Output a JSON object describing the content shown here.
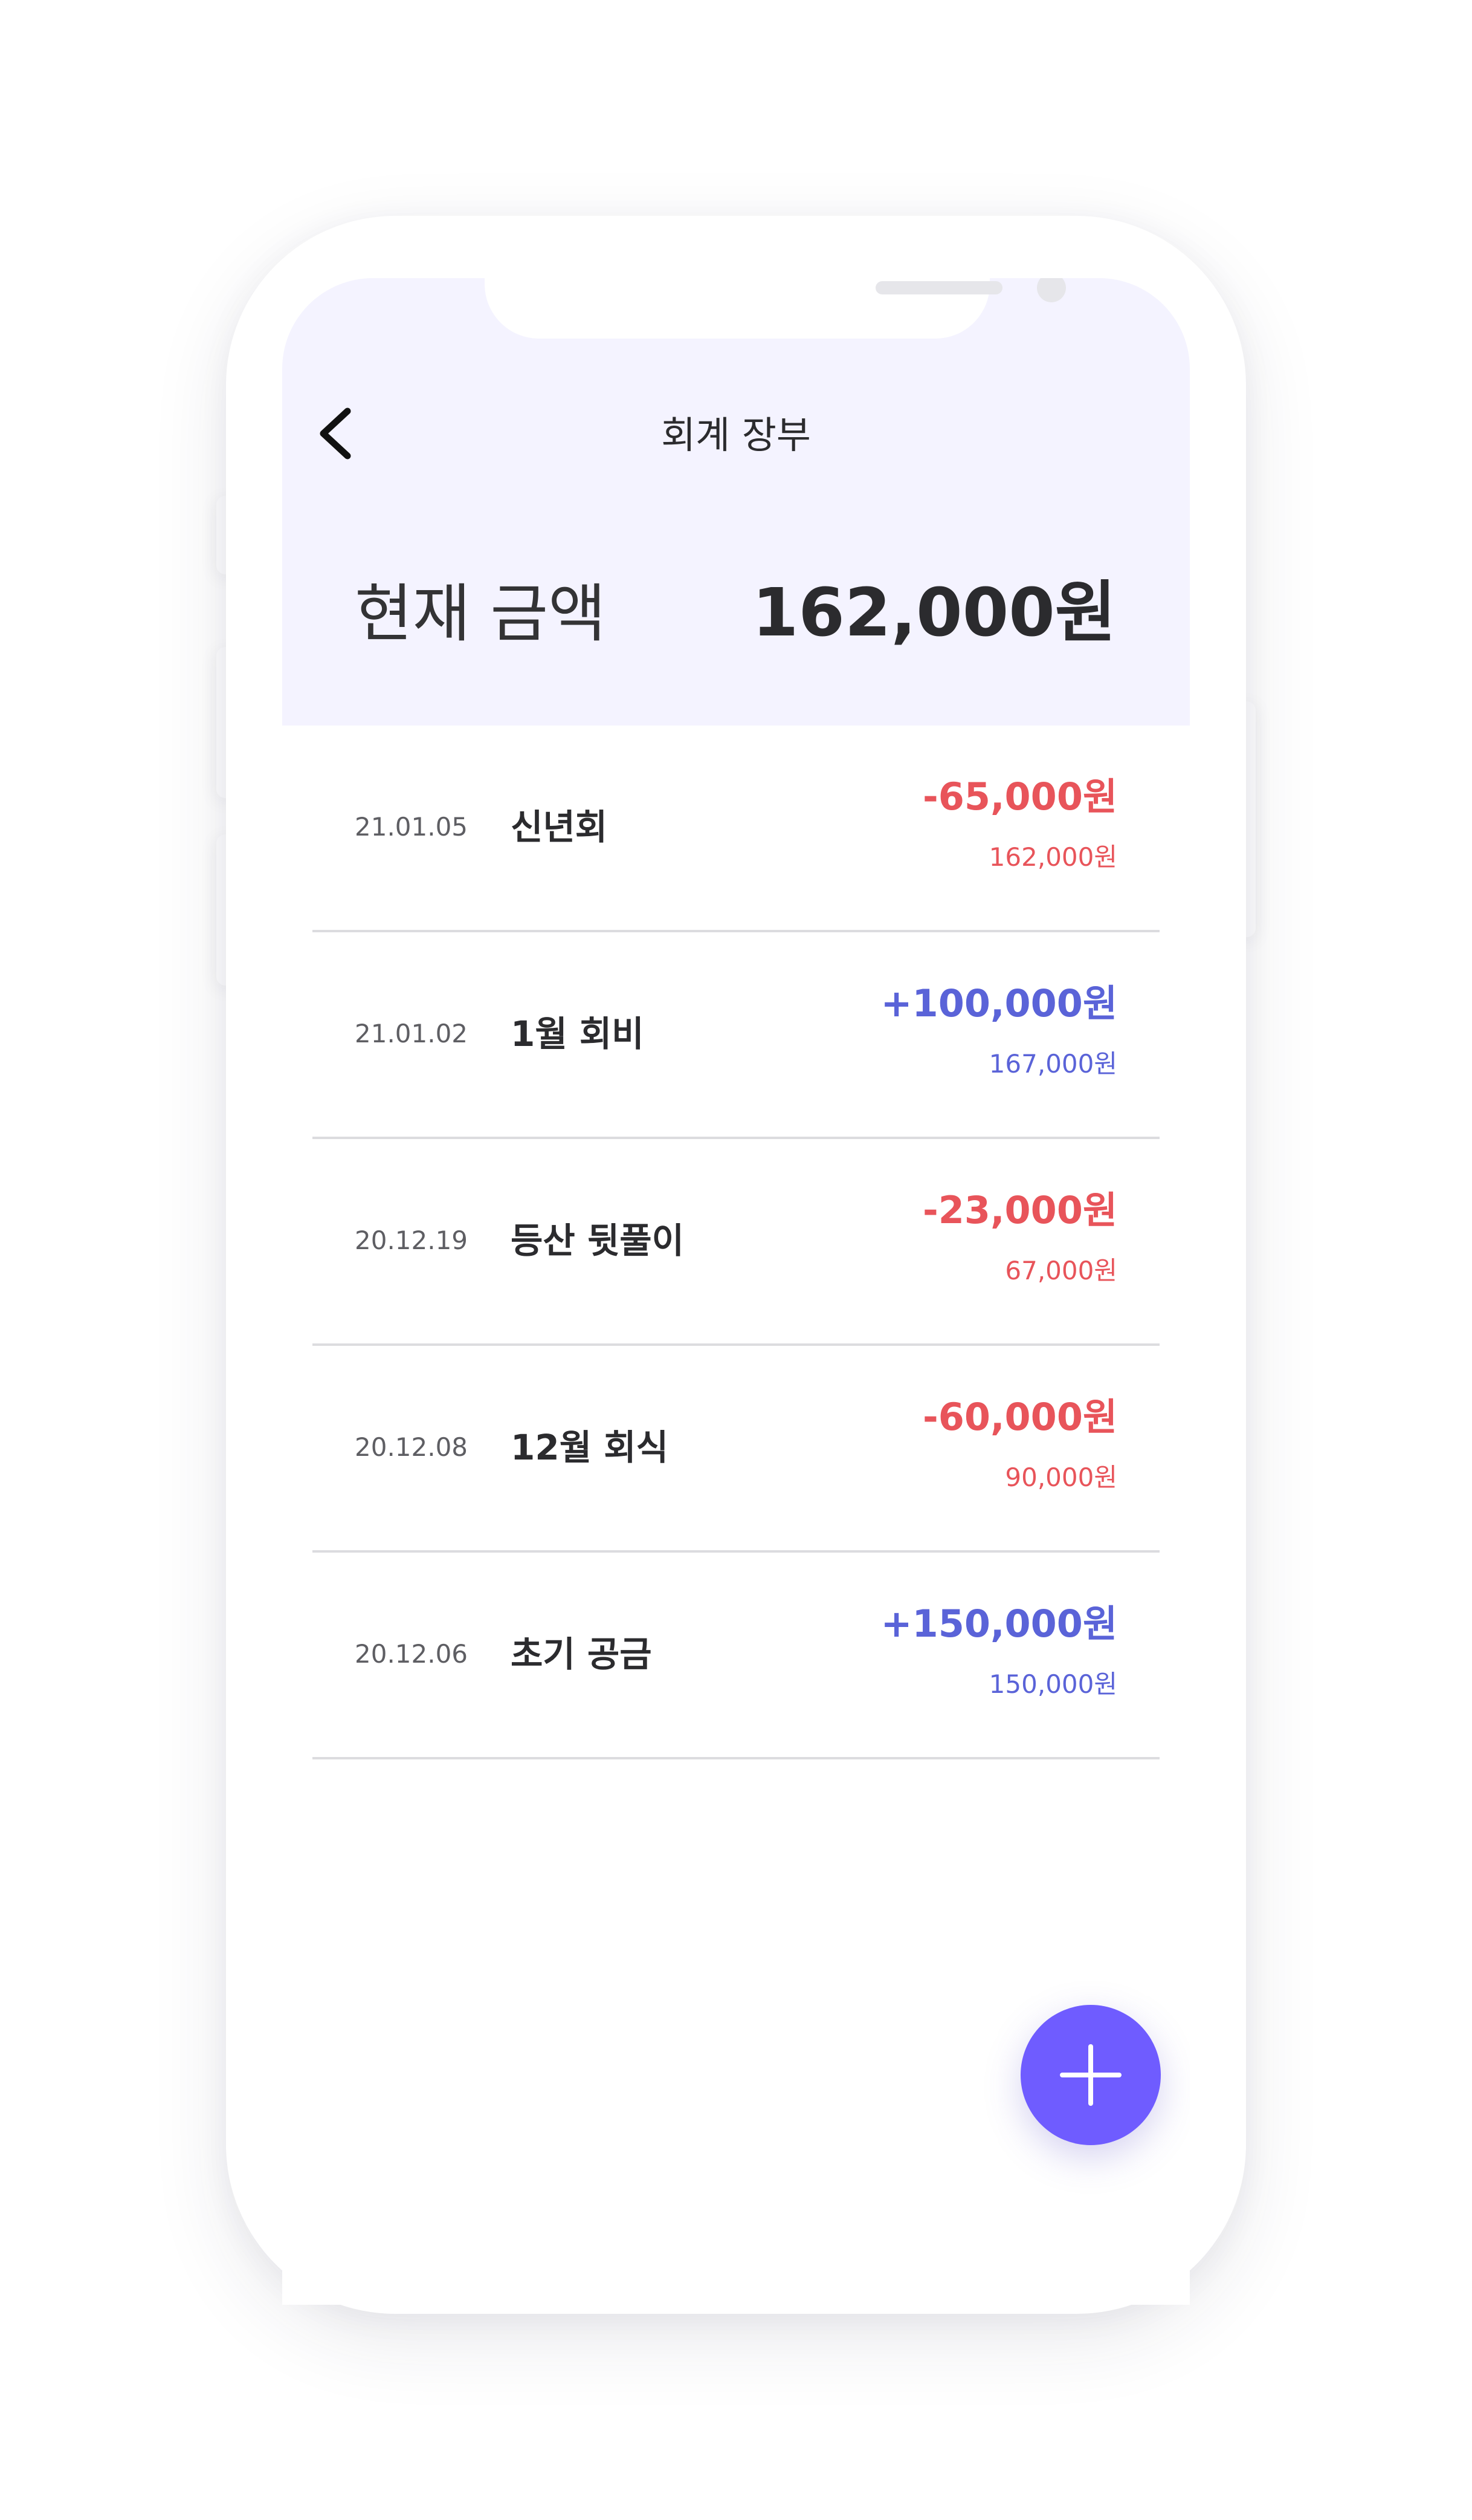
{
  "app": {
    "title": "회계 장부"
  },
  "summary": {
    "label": "현재 금액",
    "amount": "162,000원"
  },
  "transactions": [
    {
      "date": "21.01.05",
      "name": "신년회",
      "amount": "-65,000원",
      "balance": "162,000원",
      "type": "expense"
    },
    {
      "date": "21.01.02",
      "name": "1월 회비",
      "amount": "+100,000원",
      "balance": "167,000원",
      "type": "income"
    },
    {
      "date": "20.12.19",
      "name": "등산 뒷풀이",
      "amount": "-23,000원",
      "balance": "67,000원",
      "type": "expense"
    },
    {
      "date": "20.12.08",
      "name": "12월 회식",
      "amount": "-60,000원",
      "balance": "90,000원",
      "type": "expense"
    },
    {
      "date": "20.12.06",
      "name": "초기 공금",
      "amount": "+150,000원",
      "balance": "150,000원",
      "type": "income"
    }
  ],
  "icons": {
    "back": "chevron-left-icon",
    "add": "plus-icon"
  },
  "colors": {
    "expense": "#e8545a",
    "income": "#5a63d8",
    "accent": "#6f5cff",
    "header_bg": "#f4f3ff"
  }
}
